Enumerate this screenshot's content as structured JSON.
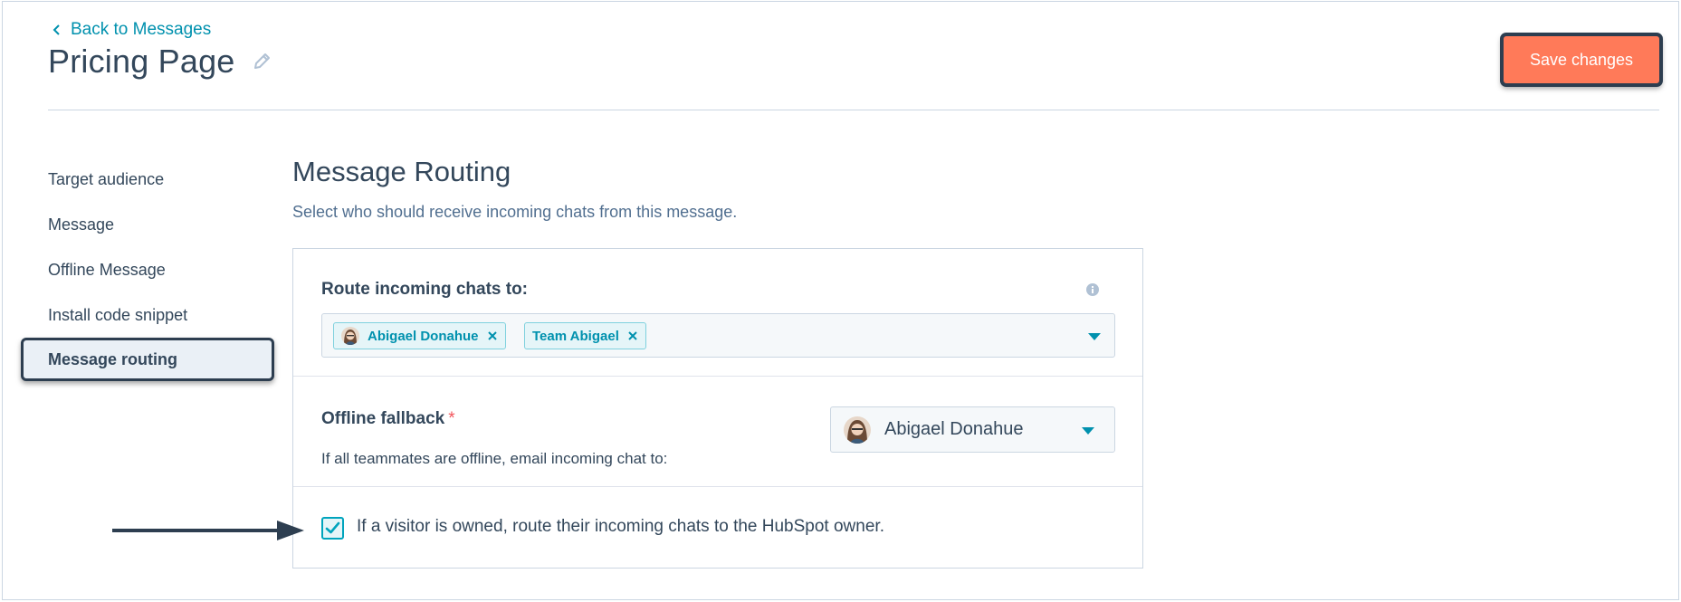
{
  "header": {
    "back_label": "Back to Messages",
    "title": "Pricing Page",
    "save_label": "Save changes"
  },
  "sidebar": {
    "items": [
      {
        "label": "Target audience",
        "active": false
      },
      {
        "label": "Message",
        "active": false
      },
      {
        "label": "Offline Message",
        "active": false
      },
      {
        "label": "Install code snippet",
        "active": false
      },
      {
        "label": "Message routing",
        "active": true
      }
    ]
  },
  "main": {
    "title": "Message Routing",
    "description": "Select who should receive incoming chats from this message.",
    "routing": {
      "label": "Route incoming chats to:",
      "tags": [
        {
          "label": "Abigael Donahue",
          "has_avatar": true
        },
        {
          "label": "Team Abigael",
          "has_avatar": false
        }
      ]
    },
    "fallback": {
      "label": "Offline fallback",
      "required_mark": "*",
      "help": "If all teammates are offline, email incoming chat to:",
      "selected": "Abigael Donahue"
    },
    "owner_routing": {
      "checked": true,
      "label": "If a visitor is owned, route their incoming chats to the HubSpot owner."
    }
  },
  "colors": {
    "accent": "#0091ae",
    "primary_button": "#ff7a59",
    "text": "#33475b",
    "annotation": "#2d3e50"
  }
}
